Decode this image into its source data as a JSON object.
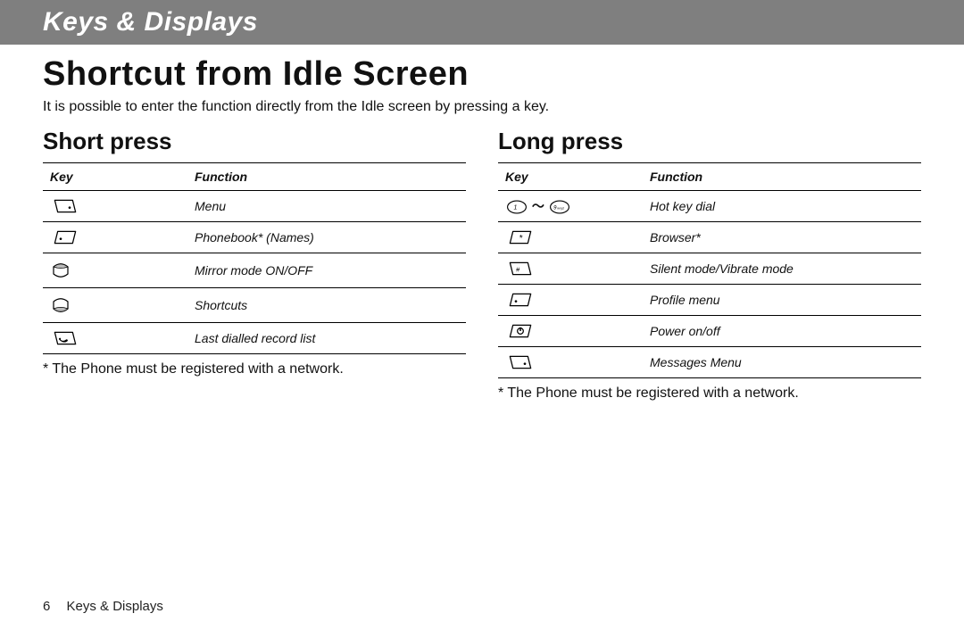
{
  "header": {
    "section_title": "Keys & Displays"
  },
  "title": "Shortcut from Idle Screen",
  "intro": "It is possible to enter the function directly from the Idle screen by pressing a key.",
  "short_press": {
    "heading": "Short press",
    "col_key": "Key",
    "col_function": "Function",
    "rows": [
      {
        "icon": "softkey-left-icon",
        "function": "Menu"
      },
      {
        "icon": "softkey-right-icon",
        "function": "Phonebook* (Names)"
      },
      {
        "icon": "nav-up-icon",
        "function": "Mirror mode ON/OFF"
      },
      {
        "icon": "nav-down-icon",
        "function": "Shortcuts"
      },
      {
        "icon": "send-key-icon",
        "function": "Last dialled record list"
      }
    ],
    "note": "* The Phone must be registered with a network."
  },
  "long_press": {
    "heading": "Long press",
    "col_key": "Key",
    "col_function": "Function",
    "rows": [
      {
        "icon": "digits-1-9-icon",
        "function": "Hot key dial"
      },
      {
        "icon": "star-key-icon",
        "function": "Browser*"
      },
      {
        "icon": "hash-key-icon",
        "function": "Silent mode/Vibrate mode"
      },
      {
        "icon": "softkey-right-icon",
        "function": "Profile menu"
      },
      {
        "icon": "end-key-icon",
        "function": "Power on/off"
      },
      {
        "icon": "softkey-left-icon",
        "function": "Messages Menu"
      }
    ],
    "note": "* The Phone must be registered with a network."
  },
  "footer": {
    "page_number": "6",
    "section": "Keys & Displays"
  }
}
